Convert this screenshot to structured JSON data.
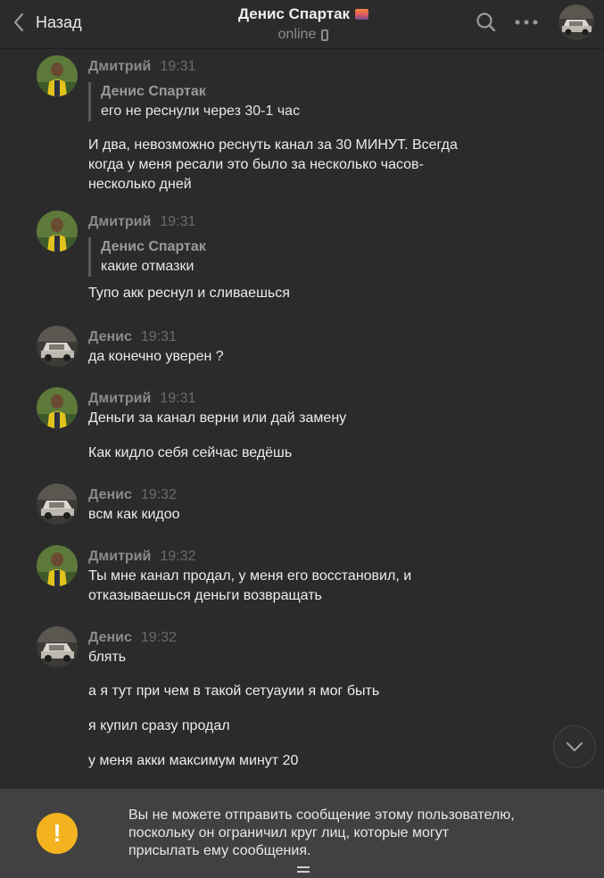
{
  "header": {
    "back_label": "Назад",
    "title": "Денис Спартак",
    "status": "online",
    "icons": [
      "chevron-left-icon",
      "search-icon",
      "more-dots-icon",
      "phone-icon"
    ]
  },
  "messages": [
    {
      "author": "Дмитрий",
      "time": "19:31",
      "avatar": "dmitry",
      "quote": {
        "author": "Денис Спартак",
        "text": "его не реснули через 30-1 час"
      },
      "lines": [
        "И два, невозможно реснуть канал за 30 МИНУТ. Всегда",
        "когда у меня ресали это было за несколько часов-",
        "несколько дней"
      ]
    },
    {
      "author": "Дмитрий",
      "time": "19:31",
      "avatar": "dmitry",
      "quote": {
        "author": "Денис Спартак",
        "text": "какие отмазки"
      },
      "lines": [
        "Тупо акк реснул и сливаешься"
      ]
    },
    {
      "author": "Денис",
      "time": "19:31",
      "avatar": "denis",
      "lines": [
        "да конечно уверен ?"
      ]
    },
    {
      "author": "Дмитрий",
      "time": "19:31",
      "avatar": "dmitry",
      "lines": [
        "Деньги за канал верни или дай замену",
        "Как кидло себя сейчас ведёшь"
      ]
    },
    {
      "author": "Денис",
      "time": "19:32",
      "avatar": "denis",
      "lines": [
        "всм как кидоо"
      ]
    },
    {
      "author": "Дмитрий",
      "time": "19:32",
      "avatar": "dmitry",
      "lines": [
        "Ты мне канал продал, у меня его восстановил, и",
        "отказываешься деньги возвращать"
      ]
    },
    {
      "author": "Денис",
      "time": "19:32",
      "avatar": "denis",
      "lines": [
        "блять",
        "а я тут при чем в такой сетуауии я мог быть",
        "я купил сразу продал",
        "у меня акки максимум минут 20"
      ]
    }
  ],
  "footer": {
    "warning_symbol": "!",
    "notice_lines": [
      "Вы не можете отправить сообщение этому пользователю,",
      "поскольку он ограничил круг лиц, которые могут",
      "присылать ему сообщения."
    ]
  },
  "colors": {
    "background": "#2b2b2c",
    "footer": "#414142",
    "warning": "#f3b31f"
  }
}
